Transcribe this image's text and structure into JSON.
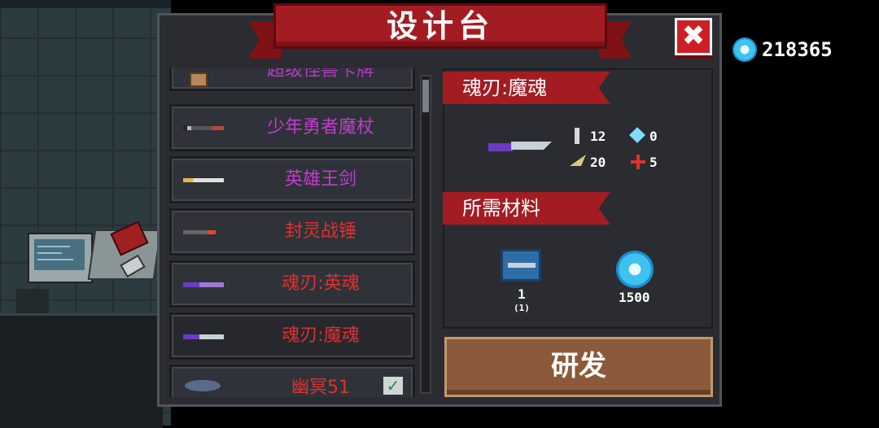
{
  "header": {
    "title": "设计台",
    "close_label": "✖"
  },
  "currency": {
    "icon": "gem-icon",
    "amount": "218365",
    "color": "#3fc2f0"
  },
  "blueprints": [
    {
      "name": "超级怪兽卡牌",
      "color": "#b23cc4",
      "icon": "card-icon",
      "partial": true
    },
    {
      "name": "少年勇者魔杖",
      "color": "#c23bd1",
      "icon": "wand-icon"
    },
    {
      "name": "英雄王剑",
      "color": "#c23bd1",
      "icon": "sword-icon"
    },
    {
      "name": "封灵战锤",
      "color": "#e03030",
      "icon": "hammer-icon"
    },
    {
      "name": "魂刃:英魂",
      "color": "#e03030",
      "icon": "soul-blade-icon"
    },
    {
      "name": "魂刃:魔魂",
      "color": "#e03030",
      "icon": "soul-blade-icon",
      "selected": true
    },
    {
      "name": "幽冥51",
      "color": "#e03030",
      "icon": "ufo-icon",
      "checked": true,
      "partial": true
    }
  ],
  "detail": {
    "weapon_name": "魂刃:魔魂",
    "weapon_icon": "soul-blade-icon",
    "stats": {
      "damage": "12",
      "energy": "0",
      "crit": "20",
      "accuracy": "5"
    },
    "materials_title": "所需材料",
    "materials": [
      {
        "icon": "blueprint-icon",
        "count": "1",
        "sub": "(1)"
      },
      {
        "icon": "gem-icon",
        "count": "1500"
      }
    ]
  },
  "actions": {
    "research_label": "研发"
  }
}
